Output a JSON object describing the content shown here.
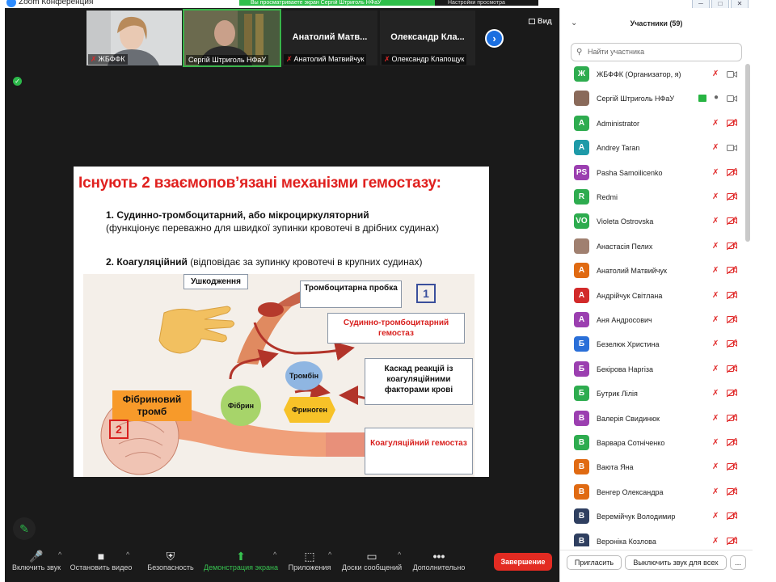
{
  "window": {
    "title": "Zoom Конференция",
    "share_banner": "Вы просматриваете экран Сергій Штриголь НФаУ",
    "share_view_label": "Настройки просмотра",
    "controls": [
      "─",
      "□",
      "✕"
    ]
  },
  "gallery": {
    "view_label": "Вид",
    "tiles": [
      {
        "big": "",
        "name": "ЖБФФК",
        "muted": true
      },
      {
        "big": "",
        "name": "Сергій Штриголь НФаУ",
        "muted": false
      },
      {
        "big": "Анатолий Матв...",
        "name": "Анатолий Матвийчук",
        "muted": true
      },
      {
        "big": "Олександр Кла...",
        "name": "Олександр Клапощук",
        "muted": true
      }
    ]
  },
  "slide": {
    "title": "Існують 2 взаємопов’язані механізми гемостазу:",
    "p1_bold": "1.  Судинно-тромбоцитарний,  або  мікроциркуляторний",
    "p1_rest": "(функціонує переважно для швидкої зупинки кровотечі в дрібних судинах)",
    "p2_bold": "2. Коагуляційний",
    "p2_rest": " (відповідає  за зупинку кровотечі в крупних судинах)",
    "labels": {
      "damage": "Ушкодження",
      "plug": "Тромбоцитарна пробка",
      "num1": "1",
      "vascular": "Судинно-тромбоцитарний гемостаз",
      "cascade": "Каскад реакцій із коагуляційними факторами крові",
      "thrombin": "Тромбін",
      "fibrin": "Фібрин",
      "fibrinogen": "Фриноген",
      "fibrin_clot": "Фібриновий тромб",
      "num2": "2",
      "coag": "Коагуляційний гемостаз"
    }
  },
  "toolbar": {
    "items": [
      {
        "label": "Включить звук",
        "icon": "🎤"
      },
      {
        "label": "Остановить видео",
        "icon": "■"
      },
      {
        "label": "Безопасность",
        "icon": "⛨"
      },
      {
        "label": "Демонстрация экрана",
        "icon": "⬆"
      },
      {
        "label": "Приложения",
        "icon": "⬚"
      },
      {
        "label": "Доски сообщений",
        "icon": "▭"
      },
      {
        "label": "Дополнительно",
        "icon": "•••"
      }
    ],
    "end_label": "Завершение"
  },
  "participants": {
    "header": "Участники (59)",
    "search_placeholder": "Найти участника",
    "list": [
      {
        "initials": "Ж",
        "color": "#2eac4f",
        "name": "ЖБФФК (Организатор, я)",
        "mic": "off",
        "cam": "on"
      },
      {
        "initials": "",
        "color": "#8a6a5a",
        "name": "Сергій Штриголь НФаУ",
        "mic": "on",
        "cam": "on",
        "sharing": true
      },
      {
        "initials": "A",
        "color": "#2eac4f",
        "name": "Administrator",
        "mic": "off",
        "cam": "off"
      },
      {
        "initials": "A",
        "color": "#1e9aa8",
        "name": "Andrey Taran",
        "mic": "off",
        "cam": "on"
      },
      {
        "initials": "PS",
        "color": "#9b3fb0",
        "name": "Pasha Samoilicenko",
        "mic": "off",
        "cam": "off"
      },
      {
        "initials": "R",
        "color": "#2eac4f",
        "name": "Redmi",
        "mic": "off",
        "cam": "off"
      },
      {
        "initials": "VO",
        "color": "#2eac4f",
        "name": "Violeta Ostrovska",
        "mic": "off",
        "cam": "off"
      },
      {
        "initials": "",
        "color": "#a08070",
        "name": "Анастасія Пелих",
        "mic": "off",
        "cam": "off"
      },
      {
        "initials": "А",
        "color": "#e06a12",
        "name": "Анатолий Матвийчук",
        "mic": "off",
        "cam": "off"
      },
      {
        "initials": "А",
        "color": "#d22a2a",
        "name": "Андрійчук Світлана",
        "mic": "off",
        "cam": "off"
      },
      {
        "initials": "А",
        "color": "#9b3fb0",
        "name": "Аня Андросович",
        "mic": "off",
        "cam": "off"
      },
      {
        "initials": "Б",
        "color": "#2a6fd8",
        "name": "Безелюк Христина",
        "mic": "off",
        "cam": "off"
      },
      {
        "initials": "Б",
        "color": "#9b3fb0",
        "name": "Бекірова Наргіза",
        "mic": "off",
        "cam": "off"
      },
      {
        "initials": "Б",
        "color": "#2eac4f",
        "name": "Бутрик Лілія",
        "mic": "off",
        "cam": "off"
      },
      {
        "initials": "В",
        "color": "#9b3fb0",
        "name": "Валерія Свидинюк",
        "mic": "off",
        "cam": "off"
      },
      {
        "initials": "В",
        "color": "#2eac4f",
        "name": "Варвара Сотніченко",
        "mic": "off",
        "cam": "off"
      },
      {
        "initials": "В",
        "color": "#e06a12",
        "name": "Ваюта Яна",
        "mic": "off",
        "cam": "off"
      },
      {
        "initials": "В",
        "color": "#e06a12",
        "name": "Венгер Олександра",
        "mic": "off",
        "cam": "off"
      },
      {
        "initials": "В",
        "color": "#2f3f60",
        "name": "Веремійчук Володимир",
        "mic": "off",
        "cam": "off"
      },
      {
        "initials": "В",
        "color": "#2f3f60",
        "name": "Вероніка Козлова",
        "mic": "off",
        "cam": "off"
      }
    ],
    "invite_label": "Пригласить",
    "mute_all_label": "Выключить звук для всех",
    "more_label": "..."
  }
}
